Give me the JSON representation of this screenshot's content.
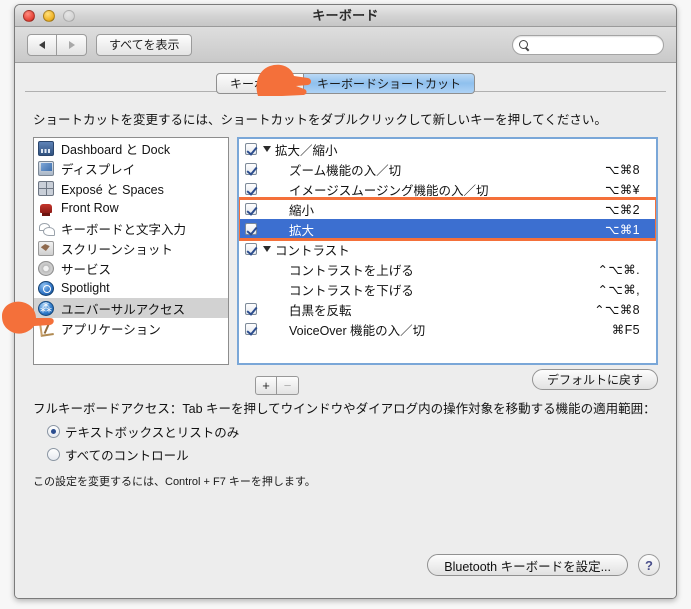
{
  "window": {
    "title": "キーボード",
    "traffic": {
      "close": "close-button",
      "minimize": "minimize-button",
      "zoom": "zoom-button"
    }
  },
  "toolbar": {
    "back_label": "◀",
    "forward_label": "▶",
    "show_all_label": "すべてを表示",
    "search": {
      "value": "",
      "placeholder": ""
    }
  },
  "tabs": [
    {
      "label": "キーボード",
      "selected": false
    },
    {
      "label": "キーボードショートカット",
      "selected": true
    }
  ],
  "instruction": "ショートカットを変更するには、ショートカットをダブルクリックして新しいキーを押してください。",
  "sidebar": {
    "items": [
      {
        "label": "Dashboard と Dock",
        "icon": "dashboard-icon",
        "selected": false
      },
      {
        "label": "ディスプレイ",
        "icon": "display-icon",
        "selected": false
      },
      {
        "label": "Exposé と Spaces",
        "icon": "expose-icon",
        "selected": false
      },
      {
        "label": "Front Row",
        "icon": "front-row-icon",
        "selected": false
      },
      {
        "label": "キーボードと文字入力",
        "icon": "keyboard-text-icon",
        "selected": false
      },
      {
        "label": "スクリーンショット",
        "icon": "screenshot-icon",
        "selected": false
      },
      {
        "label": "サービス",
        "icon": "services-gear-icon",
        "selected": false
      },
      {
        "label": "Spotlight",
        "icon": "spotlight-icon",
        "selected": false
      },
      {
        "label": "ユニバーサルアクセス",
        "icon": "universal-access-icon",
        "selected": true
      },
      {
        "label": "アプリケーション",
        "icon": "applications-icon",
        "selected": false
      }
    ]
  },
  "shortcuts": {
    "rows": [
      {
        "type": "group",
        "label": "拡大／縮小",
        "key": "",
        "checkbox": "checked",
        "selected": false,
        "highlighted": false
      },
      {
        "type": "child",
        "label": "ズーム機能の入／切",
        "key": "⌥⌘8",
        "checkbox": "checked",
        "selected": false,
        "highlighted": false
      },
      {
        "type": "child",
        "label": "イメージスムージング機能の入／切",
        "key": "⌥⌘¥",
        "checkbox": "checked",
        "selected": false,
        "highlighted": false
      },
      {
        "type": "child",
        "label": "縮小",
        "key": "⌥⌘2",
        "checkbox": "checked",
        "selected": false,
        "highlighted": true
      },
      {
        "type": "child",
        "label": "拡大",
        "key": "⌥⌘1",
        "checkbox": "checked",
        "selected": true,
        "highlighted": true
      },
      {
        "type": "group",
        "label": "コントラスト",
        "key": "",
        "checkbox": "checked",
        "selected": false,
        "highlighted": false
      },
      {
        "type": "child",
        "label": "コントラストを上げる",
        "key": "⌃⌥⌘.",
        "checkbox": "none",
        "selected": false,
        "highlighted": false
      },
      {
        "type": "child",
        "label": "コントラストを下げる",
        "key": "⌃⌥⌘,",
        "checkbox": "none",
        "selected": false,
        "highlighted": false
      },
      {
        "type": "child",
        "label": "白黒を反転",
        "key": "⌃⌥⌘8",
        "checkbox": "checked",
        "selected": false,
        "highlighted": false
      },
      {
        "type": "child",
        "label": "VoiceOver 機能の入／切",
        "key": "⌘F5",
        "checkbox": "checked",
        "selected": false,
        "highlighted": false
      }
    ]
  },
  "under_list": {
    "add_label": "+",
    "remove_label": "−",
    "restore_defaults_label": "デフォルトに戻す"
  },
  "full_keyboard_access": {
    "description": "フルキーボードアクセス：Tab キーを押してウインドウやダイアログ内の操作対象を移動する機能の適用範囲：",
    "options": [
      {
        "label": "テキストボックスとリストのみ",
        "selected": true
      },
      {
        "label": "すべてのコントロール",
        "selected": false
      }
    ],
    "note": "この設定を変更するには、Control + F7 キーを押します。"
  },
  "bottom": {
    "bluetooth_label": "Bluetooth キーボードを設定...",
    "help_label": "?"
  },
  "annotations": {
    "highlight_color": "#f4703a",
    "cursor_color": "#f4703a",
    "tab_cursor": "pointing-hand-cursor",
    "sidebar_cursor": "pointing-hand-cursor"
  }
}
